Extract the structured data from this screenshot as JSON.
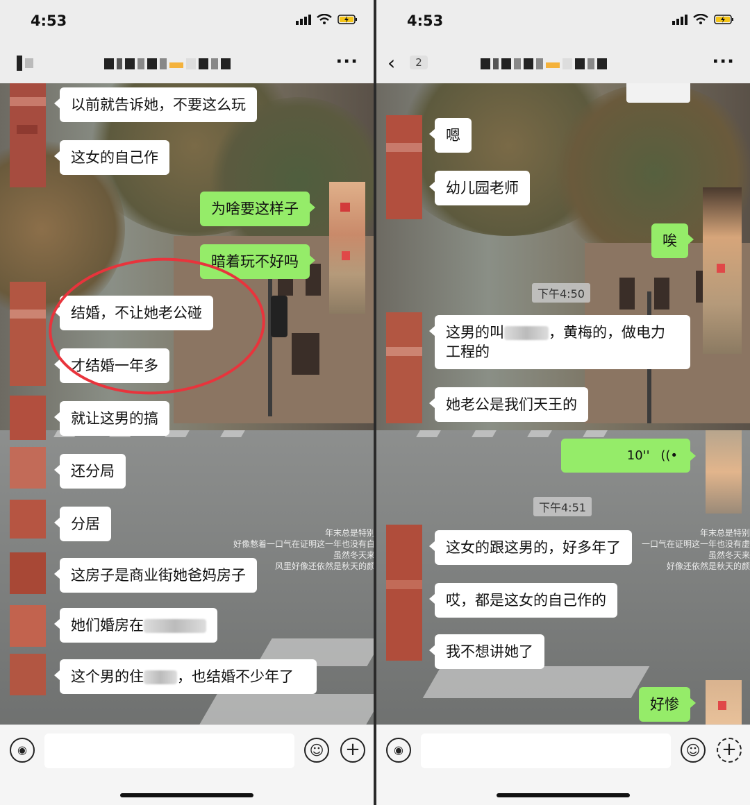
{
  "left": {
    "status": {
      "time": "4:53"
    },
    "nav": {
      "more": "···"
    },
    "messages": [
      "以前就告诉她，不要这么玩",
      "这女的自己作",
      "为啥要这样子",
      "暗着玩不好吗",
      "结婚，不让她老公碰",
      "才结婚一年多",
      "就让这男的搞",
      "还分局",
      "分居",
      "这房子是商业街她爸妈房子",
      "她们婚房在",
      "这个男的住",
      "，也结婚不少年了"
    ],
    "watermark": [
      "年末总是特别",
      "好像憋着一口气在证明这一年也没有白",
      "虽然冬天来",
      "风里好像还依然是秋天的颜"
    ]
  },
  "right": {
    "status": {
      "time": "4:53"
    },
    "nav": {
      "back": "‹",
      "back_count": "2",
      "more": "···"
    },
    "messages": {
      "m1": "嗯",
      "m2": "幼儿园老师",
      "m3": "唉",
      "ts1": "下午4:50",
      "m4a": "这男的叫",
      "m4b": "，黄梅的，做电力工程的",
      "m5": "她老公是我们天王的",
      "voice": "10''",
      "ts2": "下午4:51",
      "m6": "这女的跟这男的，好多年了",
      "m7": "哎，都是这女的自己作的",
      "m8": "我不想讲她了",
      "m9": "好惨"
    },
    "watermark": [
      "年末总是特别",
      "一口气在证明这一年也没有虚",
      "虽然冬天来",
      "好像还依然是秋天的颜"
    ]
  },
  "icons": {
    "voice": "voice-icon",
    "emoji": "emoji-icon",
    "plus": "plus-icon",
    "voice_wave": "voice-wave-icon"
  },
  "colors": {
    "bubble_out": "#95ec69",
    "bubble_in": "#ffffff",
    "highlight": "#e8343c"
  }
}
